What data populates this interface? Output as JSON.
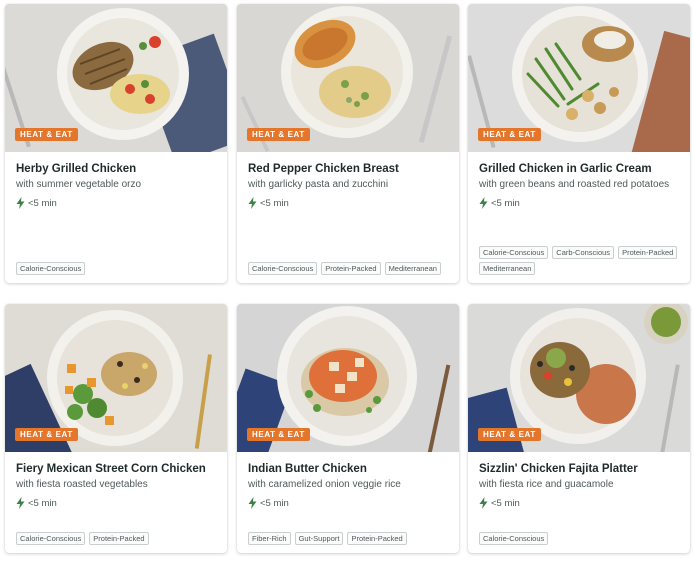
{
  "cards": [
    {
      "badge": "HEAT & EAT",
      "title": "Herby Grilled Chicken",
      "subtitle": "with summer vegetable orzo",
      "time": "<5 min",
      "tags": [
        "Calorie-Conscious"
      ]
    },
    {
      "badge": "HEAT & EAT",
      "title": "Red Pepper Chicken Breast",
      "subtitle": "with garlicky pasta and zucchini",
      "time": "<5 min",
      "tags": [
        "Calorie-Conscious",
        "Protein-Packed",
        "Mediterranean"
      ]
    },
    {
      "badge": "HEAT & EAT",
      "title": "Grilled Chicken in Garlic Cream",
      "subtitle": "with green beans and roasted red potatoes",
      "time": "<5 min",
      "tags": [
        "Calorie-Conscious",
        "Carb-Conscious",
        "Protein-Packed",
        "Mediterranean"
      ]
    },
    {
      "badge": "HEAT & EAT",
      "title": "Fiery Mexican Street Corn Chicken",
      "subtitle": "with fiesta roasted vegetables",
      "time": "<5 min",
      "tags": [
        "Calorie-Conscious",
        "Protein-Packed"
      ]
    },
    {
      "badge": "HEAT & EAT",
      "title": "Indian Butter Chicken",
      "subtitle": "with caramelized onion veggie rice",
      "time": "<5 min",
      "tags": [
        "Fiber-Rich",
        "Gut-Support",
        "Protein-Packed"
      ]
    },
    {
      "badge": "HEAT & EAT",
      "title": "Sizzlin' Chicken Fajita Platter",
      "subtitle": "with fiesta rice and guacamole",
      "time": "<5 min",
      "tags": [
        "Calorie-Conscious"
      ]
    }
  ],
  "icons": {
    "time": "lightning-bolt-icon"
  },
  "colors": {
    "badge": "#e4762c",
    "bolt": "#3f7f4a"
  }
}
